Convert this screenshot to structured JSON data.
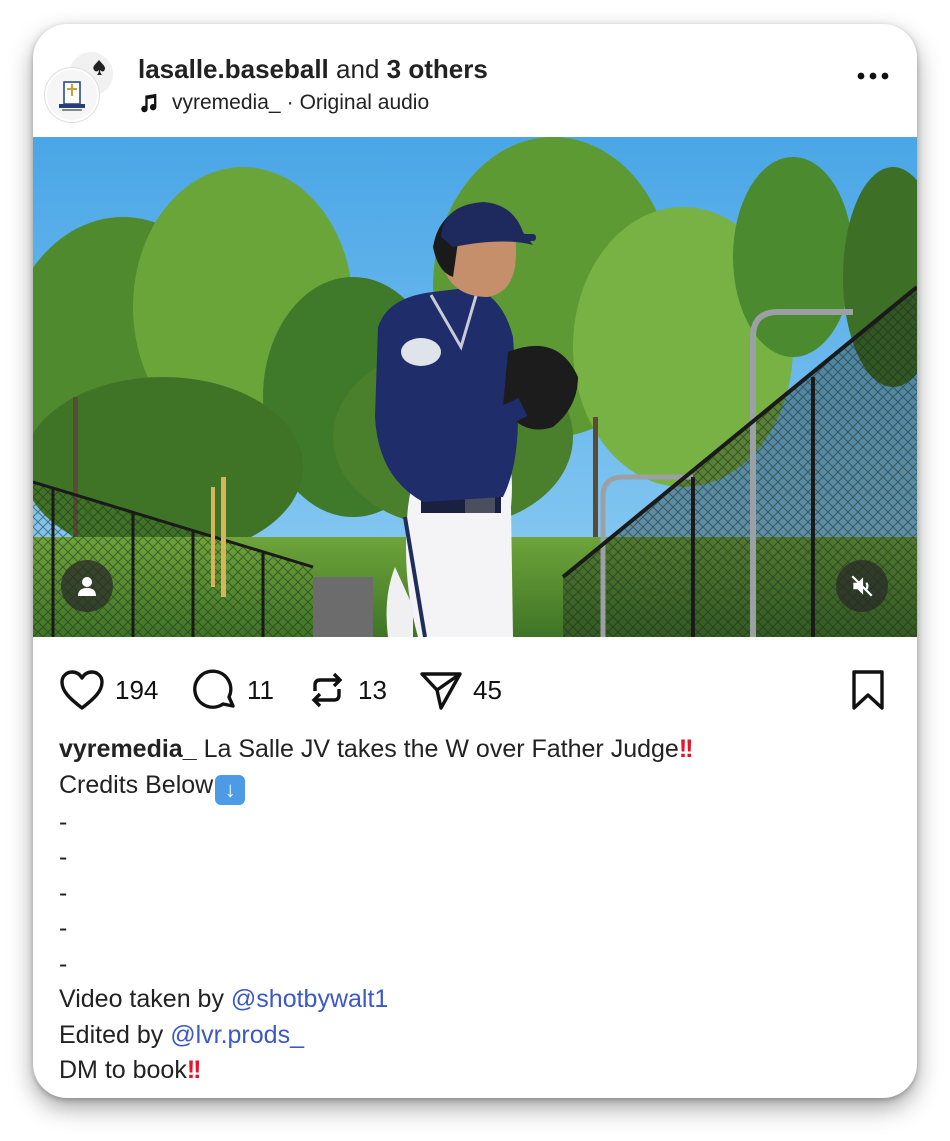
{
  "post": {
    "account": "lasalle.baseball",
    "and_text": "and",
    "others": "3 others",
    "audio_user": "vyremedia_",
    "audio_sep": "·",
    "audio_label": "Original audio"
  },
  "media": {
    "type": "video",
    "description_icons": [
      "person-icon",
      "muted-speaker-icon"
    ]
  },
  "actions": {
    "likes": "194",
    "comments": "11",
    "reposts": "13",
    "shares": "45"
  },
  "caption": {
    "user": "vyremedia_",
    "text1": "La Salle JV takes the W over Father Judge",
    "text2": "Credits Below",
    "dashes": [
      "-",
      "-",
      "-",
      "-",
      "-"
    ],
    "video_prefix": "Video taken by",
    "video_mention": "@shotbywalt1",
    "edited_prefix": "Edited by",
    "edited_mention": "@lvr.prods_",
    "dm": "DM to book"
  },
  "colors": {
    "mention": "#3b58c4",
    "exclamation": "#e0142a",
    "sky": "#5ab0e8"
  }
}
